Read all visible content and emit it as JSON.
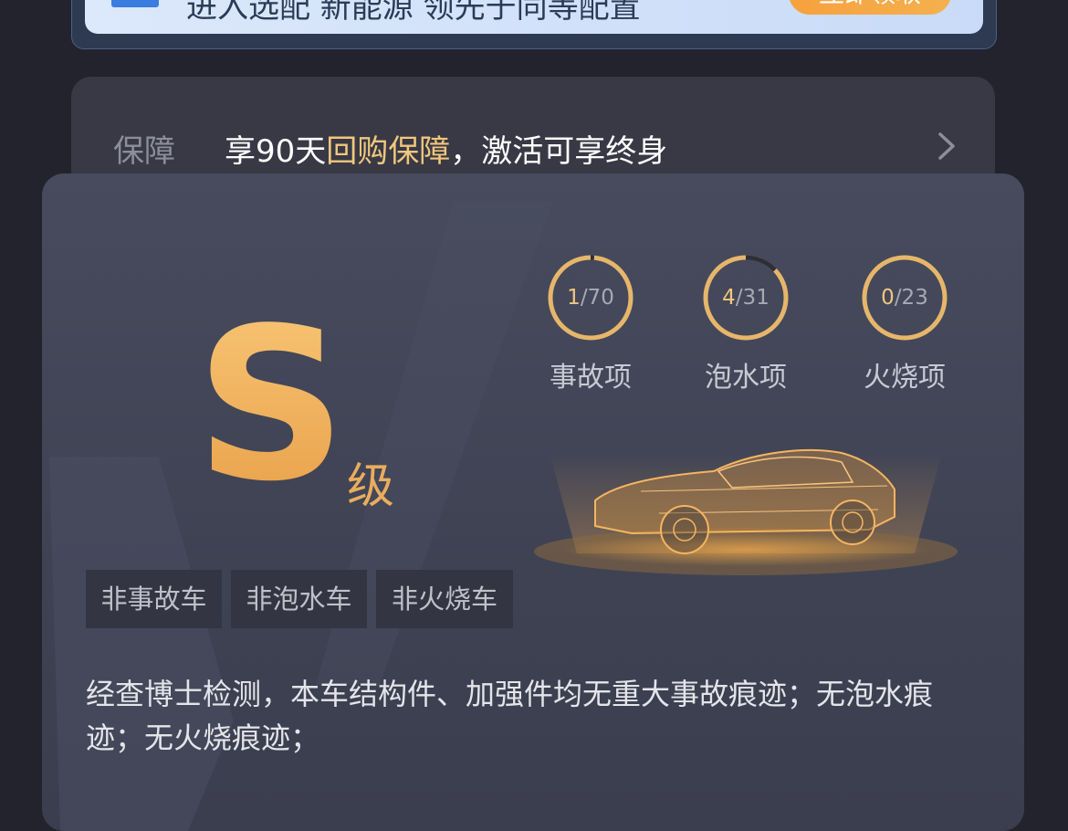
{
  "banner": {
    "text": "进入选配 新能源 领先于同等配置",
    "button_label": "立即领取"
  },
  "guarantee": {
    "label": "保障",
    "text_prefix": "享90天",
    "text_highlight": "回购保障",
    "text_suffix": "，激活可享终身"
  },
  "grade": {
    "letter": "S",
    "suffix": "级"
  },
  "stats": [
    {
      "found": "1",
      "total": "/70",
      "label": "事故项",
      "fraction": 0.0143
    },
    {
      "found": "4",
      "total": "/31",
      "label": "泡水项",
      "fraction": 0.129
    },
    {
      "found": "0",
      "total": "/23",
      "label": "火烧项",
      "fraction": 0
    }
  ],
  "tags": [
    "非事故车",
    "非泡水车",
    "非火烧车"
  ],
  "description": "经查博士检测，本车结构件、加强件均无重大事故痕迹；无泡水痕迹；无火烧痕迹；",
  "colors": {
    "accent_gold": "#f1c67d",
    "card_bg": "#454859",
    "page_bg": "#23232d"
  }
}
